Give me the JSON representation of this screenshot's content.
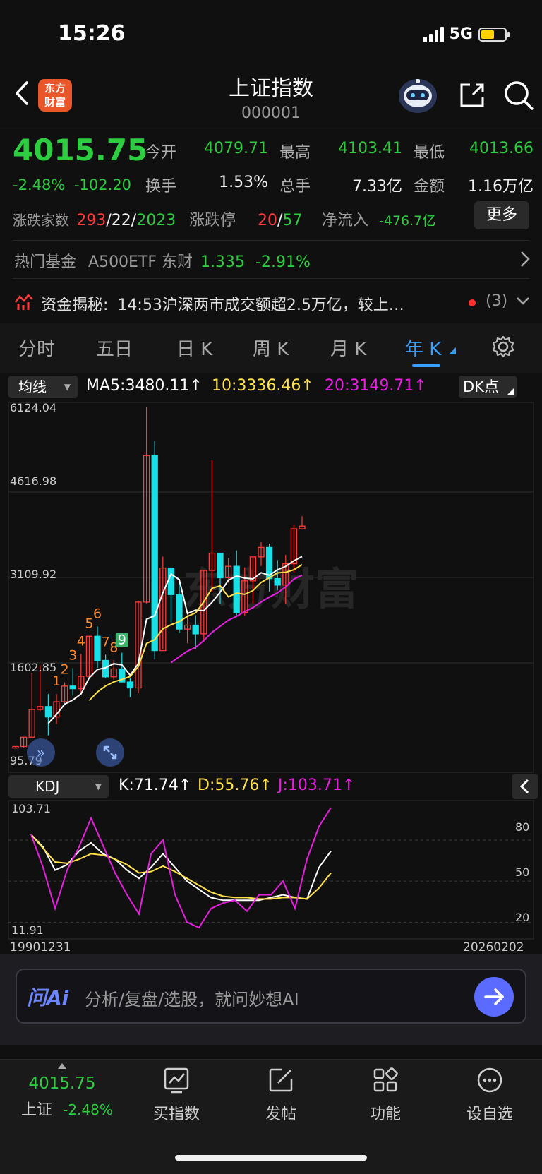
{
  "status_bar": {
    "time": "15:26",
    "network": "5G"
  },
  "header": {
    "logo_text": "东方财富",
    "title": "上证指数",
    "code": "000001"
  },
  "quote": {
    "price": "4015.75",
    "change_pct": "-2.48%",
    "change_abs": "-102.20",
    "fields": [
      {
        "label": "今开",
        "value": "4079.71",
        "color": "#2ecc40"
      },
      {
        "label": "最高",
        "value": "4103.41",
        "color": "#2ecc40"
      },
      {
        "label": "最低",
        "value": "4013.66",
        "color": "#2ecc40"
      },
      {
        "label": "换手",
        "value": "1.53%",
        "color": "#f2f2f2"
      },
      {
        "label": "总手",
        "value": "7.33亿",
        "color": "#f2f2f2"
      },
      {
        "label": "金额",
        "value": "1.16万亿",
        "color": "#f2f2f2"
      }
    ],
    "breadth_label": "涨跌家数",
    "breadth_up": "293",
    "breadth_flat": "22",
    "breadth_down": "2023",
    "limit_label": "涨跌停",
    "limit_up": "20",
    "limit_down": "57",
    "inflow_label": "净流入",
    "inflow_value": "-476.7亿",
    "more_button": "更多"
  },
  "hot_fund": {
    "label": "热门基金",
    "name": "A500ETF 东财",
    "price": "1.335",
    "change": "-2.91%"
  },
  "news": {
    "label": "资金揭秘:",
    "text": "14:53沪深两市成交额超2.5万亿，较上…",
    "count": "(3)"
  },
  "tabs": [
    "分时",
    "五日",
    "日 K",
    "周 K",
    "月 K",
    "年 K"
  ],
  "active_tab": "年 K",
  "main_chart": {
    "indicator_select": "均线",
    "ma5": "MA5:3480.11↑",
    "ma10": "10:3336.46↑",
    "ma20": "20:3149.71↑",
    "dk_button": "DK点",
    "y_labels": [
      "6124.04",
      "4616.98",
      "3109.92",
      "1602.85",
      "95.79"
    ],
    "td_marks": [
      "1",
      "2",
      "3",
      "4",
      "5",
      "6",
      "7",
      "8",
      "9"
    ],
    "watermark": "东方财富"
  },
  "sub_chart": {
    "indicator_select": "KDJ",
    "k": "K:71.74↑",
    "d": "D:55.76↑",
    "j": "J:103.71↑",
    "y_max": "103.71",
    "y_min": "11.91",
    "right_labels": [
      "80",
      "50",
      "20"
    ],
    "x_start": "19901231",
    "x_end": "20260202"
  },
  "chart_data": {
    "type": "candlestick",
    "period": "yearly",
    "ylim": [
      95.79,
      6124.04
    ],
    "indicators": [
      "MA5",
      "MA10",
      "MA20",
      "KDJ"
    ],
    "candles": [
      [
        100,
        128,
        96,
        127
      ],
      [
        127,
        292,
        105,
        292
      ],
      [
        292,
        1429,
        293,
        780
      ],
      [
        780,
        1559,
        750,
        833
      ],
      [
        833,
        1052,
        325,
        648
      ],
      [
        648,
        1053,
        524,
        917
      ],
      [
        917,
        1258,
        867,
        1194
      ],
      [
        1194,
        1510,
        1025,
        1147
      ],
      [
        1147,
        1757,
        1047,
        1366
      ],
      [
        1366,
        2073,
        1341,
        2073
      ],
      [
        2073,
        2245,
        1514,
        1646
      ],
      [
        1646,
        1748,
        1339,
        1357
      ],
      [
        1357,
        1649,
        1307,
        1497
      ],
      [
        1497,
        1783,
        1259,
        1266
      ],
      [
        1266,
        1329,
        998,
        1161
      ],
      [
        1161,
        2698,
        1067,
        2675
      ],
      [
        2675,
        6124,
        2650,
        5261
      ],
      [
        5261,
        5522,
        1664,
        1820
      ],
      [
        1820,
        3478,
        1844,
        3277
      ],
      [
        3277,
        3186,
        2319,
        2808
      ],
      [
        2808,
        3067,
        2132,
        2199
      ],
      [
        2199,
        2478,
        1949,
        2269
      ],
      [
        2269,
        2444,
        1849,
        2115
      ],
      [
        2115,
        3239,
        1974,
        3234
      ],
      [
        3234,
        5178,
        2851,
        3539
      ],
      [
        3539,
        3301,
        2638,
        3104
      ],
      [
        3104,
        3450,
        3016,
        3307
      ],
      [
        3307,
        3587,
        2440,
        2494
      ],
      [
        2494,
        3288,
        2440,
        3050
      ],
      [
        3050,
        3474,
        2646,
        3473
      ],
      [
        3473,
        3731,
        3312,
        3640
      ],
      [
        3640,
        3708,
        2863,
        3089
      ],
      [
        3089,
        3418,
        2885,
        2975
      ],
      [
        2975,
        3509,
        2635,
        3352
      ],
      [
        3352,
        4034,
        3200,
        3969
      ],
      [
        3969,
        4190,
        4013,
        4016
      ]
    ],
    "kdj_range": [
      11.91,
      103.71
    ],
    "series": [
      {
        "name": "K",
        "values": [
          84,
          75,
          58,
          62,
          72,
          78,
          70,
          66,
          58,
          52,
          60,
          70,
          60,
          50,
          44,
          38,
          36,
          36,
          36,
          36,
          38,
          40,
          38,
          37,
          60,
          72
        ]
      },
      {
        "name": "D",
        "values": [
          84,
          74,
          64,
          63,
          66,
          70,
          69,
          66,
          62,
          56,
          57,
          61,
          57,
          52,
          47,
          42,
          39,
          38,
          38,
          37,
          37,
          38,
          38,
          37,
          45,
          56
        ]
      },
      {
        "name": "J",
        "values": [
          84,
          60,
          30,
          58,
          75,
          96,
          76,
          56,
          40,
          26,
          70,
          80,
          40,
          20,
          16,
          30,
          34,
          36,
          28,
          40,
          40,
          50,
          30,
          66,
          90,
          104
        ]
      }
    ]
  },
  "ask_ai": {
    "logo": "问Ai",
    "placeholder": "分析/复盘/选股，就问妙想AI"
  },
  "bottom_nav": {
    "index_price": "4015.75",
    "index_name": "上证",
    "index_change": "-2.48%",
    "items": [
      "买指数",
      "发帖",
      "功能",
      "设自选"
    ]
  }
}
